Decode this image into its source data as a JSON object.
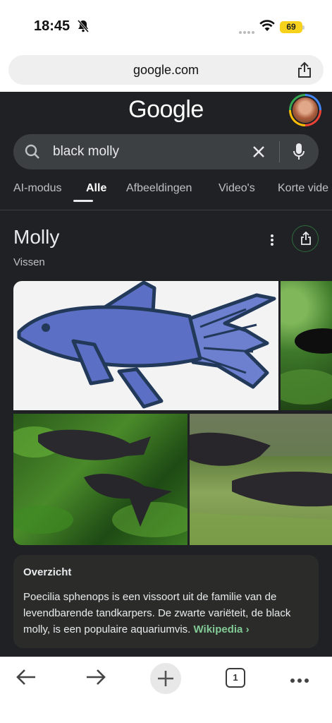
{
  "status": {
    "time": "18:45",
    "battery": "69"
  },
  "browser": {
    "url": "google.com"
  },
  "google": {
    "logo": "Google",
    "search_query": "black molly",
    "tabs": [
      {
        "label": "AI-modus",
        "active": false
      },
      {
        "label": "Alle",
        "active": true
      },
      {
        "label": "Afbeeldingen",
        "active": false
      },
      {
        "label": "Video's",
        "active": false
      },
      {
        "label": "Korte vide",
        "active": false
      }
    ]
  },
  "knowledge_panel": {
    "title": "Molly",
    "subtitle": "Vissen",
    "overview": {
      "heading": "Overzicht",
      "text": "Poecilia sphenops is een vissoort uit de familie van de levendbarende tandkarpers. De zwarte variëteit, de black molly, is een populaire aquariumvis.",
      "source_link": "Wikipedia ›"
    }
  },
  "toolbar": {
    "tab_count": "1"
  },
  "colors": {
    "page_bg": "#202124",
    "battery": "#f7d21d",
    "link_green": "#81c995",
    "fish_blue": "#5b6fc4"
  }
}
